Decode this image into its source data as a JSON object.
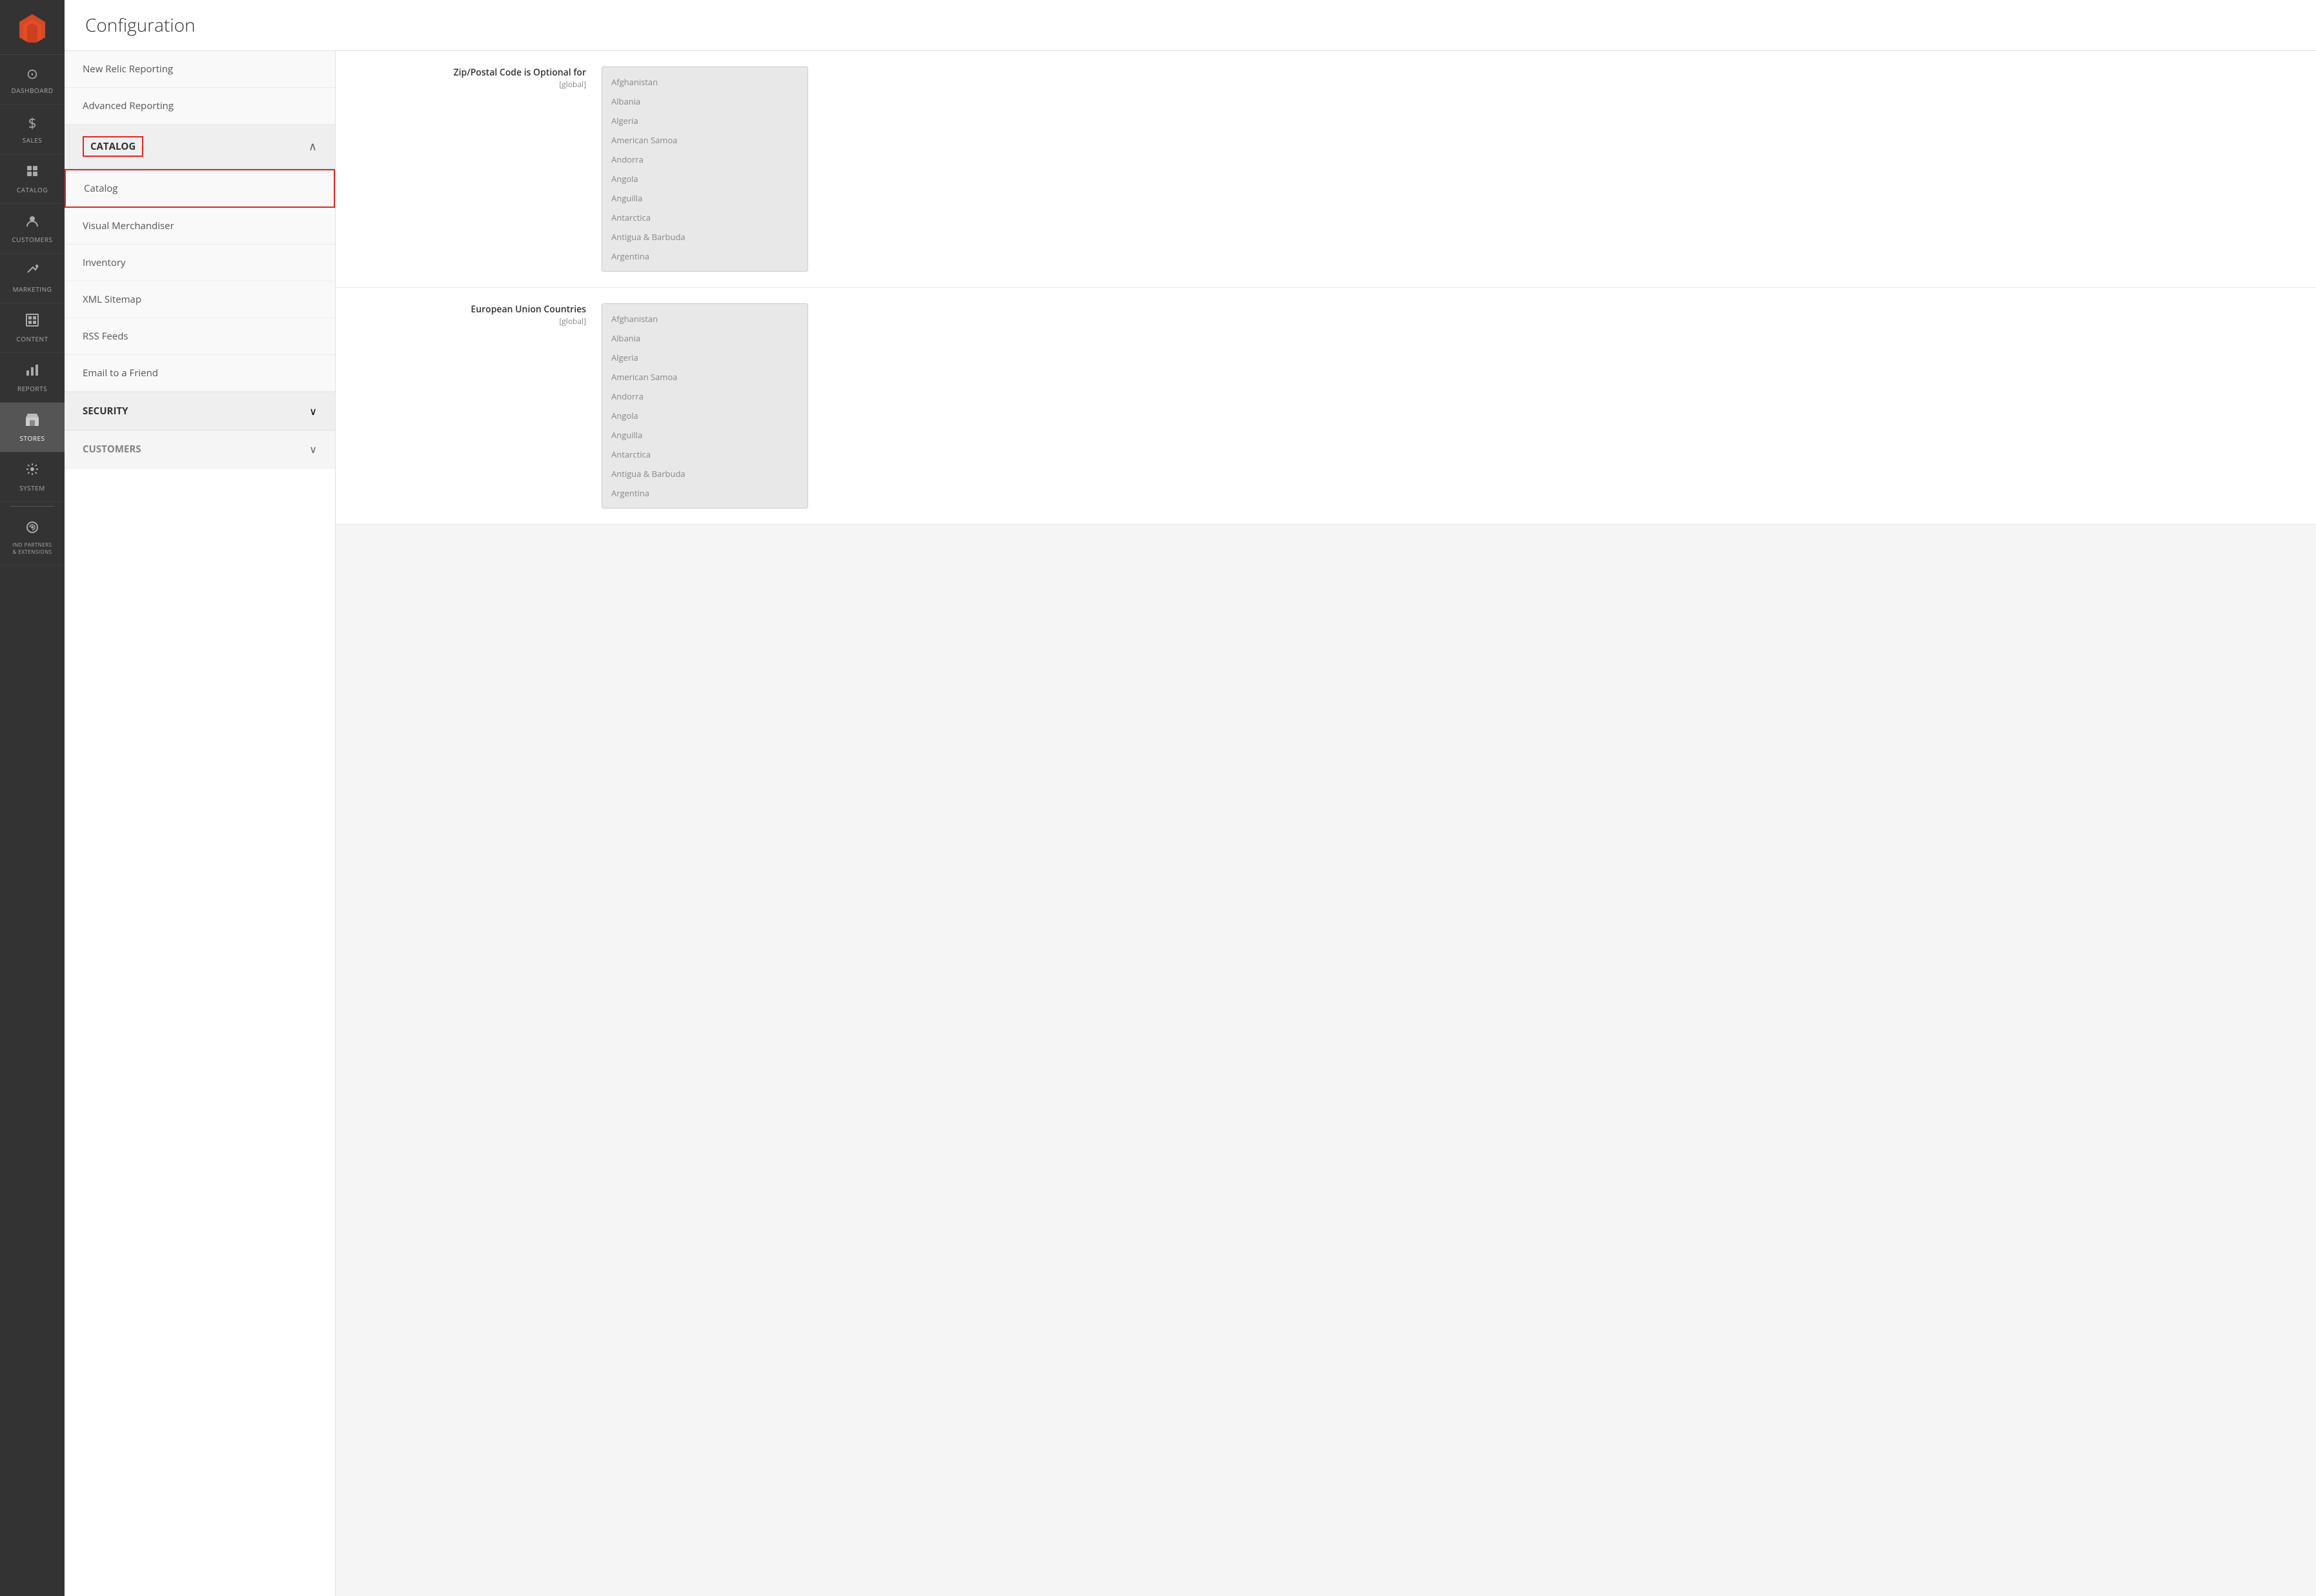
{
  "app": {
    "title": "Configuration"
  },
  "sidebar": {
    "logo_alt": "Magento",
    "items": [
      {
        "id": "dashboard",
        "label": "DASHBOARD",
        "icon": "⊙"
      },
      {
        "id": "sales",
        "label": "SALES",
        "icon": "$"
      },
      {
        "id": "catalog",
        "label": "CATALOG",
        "icon": "◈"
      },
      {
        "id": "customers",
        "label": "CUSTOMERS",
        "icon": "👤"
      },
      {
        "id": "marketing",
        "label": "MARKETING",
        "icon": "📢"
      },
      {
        "id": "content",
        "label": "CONTENT",
        "icon": "▣"
      },
      {
        "id": "reports",
        "label": "REPORTS",
        "icon": "📊"
      },
      {
        "id": "stores",
        "label": "STORES",
        "icon": "🏪",
        "active": true
      },
      {
        "id": "system",
        "label": "SYSTEM",
        "icon": "⚙"
      },
      {
        "id": "partners",
        "label": "IND PARTNERS & EXTENSIONS",
        "icon": "🔧"
      }
    ]
  },
  "left_nav": {
    "plain_items": [
      {
        "id": "new-relic",
        "label": "New Relic Reporting"
      },
      {
        "id": "advanced-reporting",
        "label": "Advanced Reporting"
      }
    ],
    "catalog_section": {
      "title": "CATALOG",
      "expanded": true,
      "chevron": "∧",
      "sub_items": [
        {
          "id": "catalog",
          "label": "Catalog",
          "active": true
        },
        {
          "id": "visual-merchandiser",
          "label": "Visual Merchandiser"
        },
        {
          "id": "inventory",
          "label": "Inventory"
        },
        {
          "id": "xml-sitemap",
          "label": "XML Sitemap"
        },
        {
          "id": "rss-feeds",
          "label": "RSS Feeds"
        },
        {
          "id": "email-to-friend",
          "label": "Email to a Friend"
        }
      ]
    },
    "security_section": {
      "title": "SECURITY",
      "expanded": false,
      "chevron": "∨"
    },
    "customers_section": {
      "title": "CUSTOMERS",
      "expanded": false,
      "chevron": "∨"
    }
  },
  "right_panel": {
    "zip_section": {
      "label_main": "Zip/Postal Code is Optional for",
      "label_sub": "[global]",
      "countries": [
        "Afghanistan",
        "Albania",
        "Algeria",
        "American Samoa",
        "Andorra",
        "Angola",
        "Anguilla",
        "Antarctica",
        "Antigua & Barbuda",
        "Argentina"
      ]
    },
    "eu_section": {
      "label_main": "European Union Countries",
      "label_sub": "[global]",
      "countries": [
        "Afghanistan",
        "Albania",
        "Algeria",
        "American Samoa",
        "Andorra",
        "Angola",
        "Anguilla",
        "Antarctica",
        "Antigua & Barbuda",
        "Argentina"
      ]
    }
  }
}
